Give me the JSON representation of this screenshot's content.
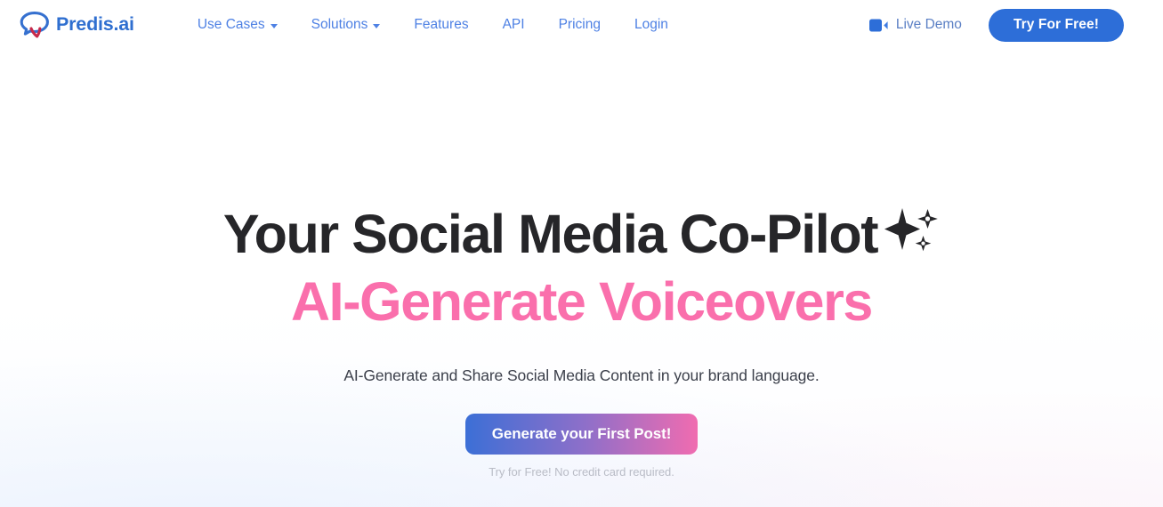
{
  "header": {
    "brand": {
      "name": "Predis.ai",
      "logo_icon": "speech-bubble-logo",
      "color": "#2f6fd0"
    },
    "nav": [
      {
        "label": "Use Cases",
        "has_dropdown": true
      },
      {
        "label": "Solutions",
        "has_dropdown": true
      },
      {
        "label": "Features",
        "has_dropdown": false
      },
      {
        "label": "API",
        "has_dropdown": false
      },
      {
        "label": "Pricing",
        "has_dropdown": false
      },
      {
        "label": "Login",
        "has_dropdown": false
      }
    ],
    "nav_color": "#4e81e4",
    "live_demo": {
      "label": "Live Demo",
      "icon": "video-camera-icon"
    },
    "cta": {
      "label": "Try For Free!",
      "color": "#2d6ed8"
    }
  },
  "hero": {
    "title_line1": "Your Social Media Co-Pilot",
    "title_sparkle_icon": "sparkles-icon",
    "title_line2": "AI-Generate Voiceovers",
    "accent_color": "#fa6fac",
    "subtitle": "AI-Generate and Share Social Media Content in your brand language.",
    "cta": {
      "label": "Generate your First Post!",
      "gradient_from": "#3c6fd6",
      "gradient_to": "#f06cb0"
    },
    "note": "Try for Free! No credit card required."
  }
}
